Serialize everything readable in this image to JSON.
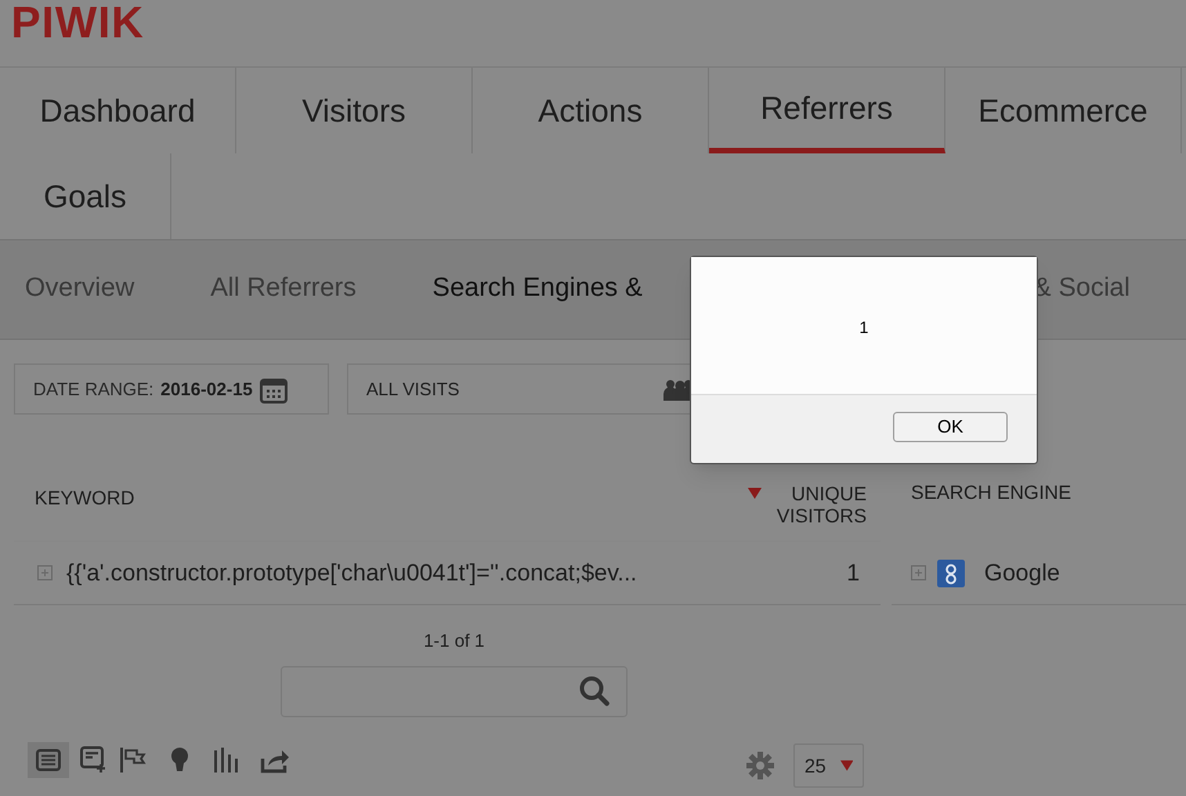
{
  "logo": "PIWIK",
  "main_tabs": [
    {
      "label": "Dashboard",
      "selected": false
    },
    {
      "label": "Visitors",
      "selected": false
    },
    {
      "label": "Actions",
      "selected": false
    },
    {
      "label": "Referrers",
      "selected": true
    },
    {
      "label": "Ecommerce",
      "selected": false
    },
    {
      "label": "Goals",
      "selected": false
    }
  ],
  "sub_tabs": [
    {
      "label": "Overview",
      "selected": false
    },
    {
      "label": "All Referrers",
      "selected": false
    },
    {
      "label": "Search Engines &",
      "selected": true
    },
    {
      "label": "& Social",
      "selected": false
    }
  ],
  "date_range": {
    "label": "DATE RANGE:",
    "value": "2016-02-15"
  },
  "segment": {
    "label": "ALL VISITS"
  },
  "keyword_table": {
    "columns": [
      "KEYWORD",
      "UNIQUE VISITORS"
    ],
    "rows": [
      {
        "keyword": "{{'a'.constructor.prototype['char\\u0041t']=''.concat;$ev...",
        "visitors": "1"
      }
    ],
    "pagination": "1-1 of 1"
  },
  "engine_table": {
    "columns": [
      "SEARCH ENGINE"
    ],
    "rows": [
      {
        "name": "Google"
      }
    ]
  },
  "toolbar": {
    "limit": "25"
  },
  "dialog": {
    "message": "1",
    "button": "OK"
  }
}
